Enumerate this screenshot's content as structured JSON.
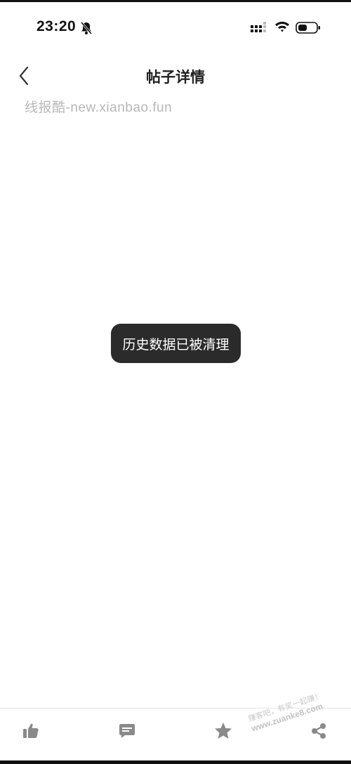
{
  "status_bar": {
    "time": "23:20",
    "icons": [
      "bell-muted-icon",
      "signal-icon",
      "wifi-icon",
      "battery-icon"
    ]
  },
  "nav": {
    "title": "帖子详情",
    "back_icon": "chevron-left-icon"
  },
  "source_watermark": "线报酷-new.xianbao.fun",
  "toast": {
    "message": "历史数据已被清理"
  },
  "bottom_bar": {
    "buttons": [
      "thumbs-up-icon",
      "comment-icon",
      "star-icon",
      "share-icon"
    ]
  },
  "corner_watermark": {
    "line1": "赚客吧，有奖一起赚！",
    "line2": "www.zuanke8.com"
  },
  "colors": {
    "toast_bg": "#2b2b2b",
    "icon_gray": "#8a8a8a",
    "watermark": "#b8b8b8"
  }
}
